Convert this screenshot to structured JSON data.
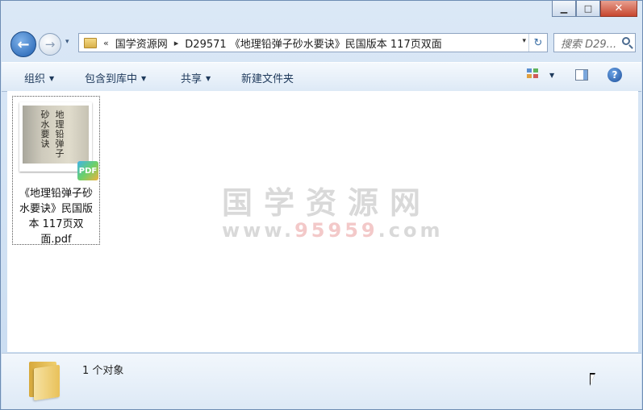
{
  "window": {
    "minimize_glyph": "▁",
    "maximize_glyph": "□",
    "close_glyph": "✕"
  },
  "nav": {
    "back_glyph": "←",
    "forward_glyph": "→",
    "dropdown_glyph": "▾"
  },
  "address": {
    "overflow": "«",
    "crumbs": [
      "国学资源网",
      "D29571 《地理铅弹子砂水要诀》民国版本 117页双面"
    ],
    "separator": "▸",
    "dropdown_glyph": "▾",
    "refresh_glyph": "↻"
  },
  "search": {
    "placeholder": "搜索 D29..."
  },
  "toolbar": {
    "organize": "组织",
    "include_in_library": "包含到库中",
    "share": "共享",
    "new_folder": "新建文件夹",
    "help_glyph": "?"
  },
  "files": [
    {
      "name": "《地理铅弹子砂水要诀》民国版本 117页双面.pdf",
      "badge": "PDF",
      "cover_text": [
        "地理铅弹子",
        "砂水要诀"
      ]
    }
  ],
  "watermark": {
    "title": "国学资源网",
    "url_prefix": "www.",
    "url_number": "95959",
    "url_suffix": ".com"
  },
  "status": {
    "count_text": "1 个对象"
  },
  "colors": {
    "accent": "#1e395b",
    "window_bg": "#dbe8f6",
    "close_red": "#c7462e"
  }
}
